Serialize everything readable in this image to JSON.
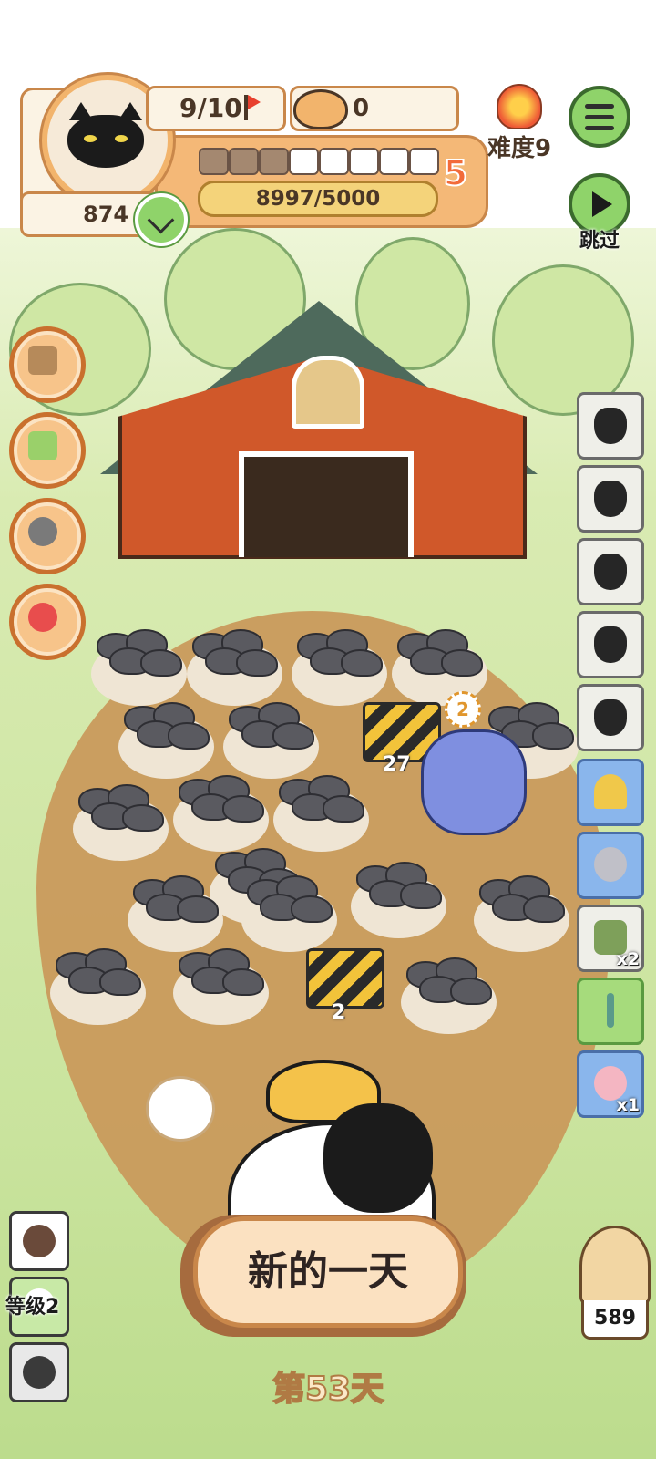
{
  "hud": {
    "lives": "9/10",
    "food": "0",
    "score": "874",
    "xp": "8997/5000",
    "level": "5",
    "segments_filled": 3,
    "segments_total": 8,
    "difficulty": "难度9",
    "skip_label": "跳过"
  },
  "board": {
    "barrier_timers": [
      "27",
      "2"
    ],
    "dragon_badge": "2"
  },
  "inventory": {
    "counts": [
      "x2",
      "x1"
    ]
  },
  "bottom": {
    "new_day": "新的一天",
    "day": "第53天",
    "level_label": "等级2",
    "hamster_count": "589"
  },
  "colors": {
    "accent_orange": "#f4b877",
    "menu_green": "#8fd36a",
    "field_brown": "#c99a5c",
    "barn_red": "#d0582a"
  },
  "icons": [
    "cat-avatar-icon",
    "flag-icon",
    "cat-food-bowl-icon",
    "heart-check-icon",
    "flame-icon",
    "menu-icon",
    "play-icon",
    "trash-bag-icon",
    "trophy-icon",
    "robot-mouse-icon",
    "cheese-card-icon",
    "caduceus-icon",
    "pig-poster-icon",
    "hamster-icon"
  ]
}
